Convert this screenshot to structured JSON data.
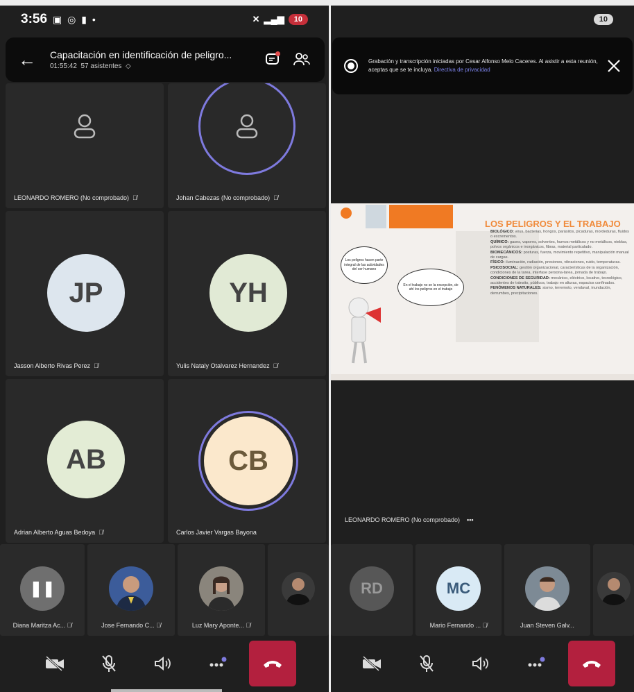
{
  "left": {
    "status": {
      "time": "3:56",
      "battery": "10"
    },
    "header": {
      "title": "Capacitación en identificación de peligro...",
      "duration": "01:55:42",
      "attendees": "57 asistentes"
    },
    "tiles": [
      {
        "name": "LEONARDO ROMERO (No comprobado)"
      },
      {
        "name": "Johan Cabezas (No comprobado)"
      },
      {
        "name": "Jasson Alberto Rivas Perez",
        "initials": "JP",
        "color": "#dde6ee"
      },
      {
        "name": "Yulis Nataly Otalvarez Hernandez",
        "initials": "YH",
        "color": "#e1ead5"
      },
      {
        "name": "Adrian Alberto Aguas Bedoya",
        "initials": "AB",
        "color": "#e3ecd5"
      },
      {
        "name": "Carlos Javier Vargas Bayona",
        "initials": "CB",
        "color": "#fbe8cc"
      }
    ],
    "strip": [
      {
        "name": "Diana Maritza Ac..."
      },
      {
        "name": "Jose Fernando C..."
      },
      {
        "name": "Luz Mary Aponte..."
      },
      {
        "name": ""
      }
    ]
  },
  "right": {
    "status": {
      "battery": "10"
    },
    "banner": {
      "text": "Grabación y transcripción iniciadas por Cesar Alfonso Melo Caceres. Al asistir a esta reunión, aceptas que se te incluya.",
      "link": "Directiva de privacidad"
    },
    "slide": {
      "title": "LOS PELIGROS Y EL TRABAJO",
      "bubble1": "Los peligros hacen parte integral de las actividades del ser humano",
      "bubble2": "En el trabajo no se la excepción, de ahí los peligros en el trabajo",
      "lines": [
        {
          "label": "BIOLÓGICO:",
          "text": "virus, bacterias, hongos, parásitos, picaduras, mordeduras, fluidos o excrementos."
        },
        {
          "label": "QUÍMICO:",
          "text": "gases, vapores, solventes, humos metálicos y no metálicos, nieblas, polvos orgánicos e inorgánicos, fibras, material particulado."
        },
        {
          "label": "BIOMECÁNICOS:",
          "text": "posturas, fuerza, movimiento repetitivo, manipulación manual de cargas."
        },
        {
          "label": "FÍSICO:",
          "text": "iluminación, radiación, presiones, vibraciones, ruido, temperaturas."
        },
        {
          "label": "PSICOSOCIAL:",
          "text": "gestión organizacional, características de la organización, condiciones de la tarea, interfase persona-tarea, jornada de trabajo."
        },
        {
          "label": "CONDICIONES DE SEGURIDAD:",
          "text": "mecánico, eléctrico, locativo, tecnológico, accidentes de tránsito, públicos, trabajo en alturas, espacios confinados."
        },
        {
          "label": "FENÓMENOS NATURALES:",
          "text": "sismo, terremoto, vendaval, inundación, derrumbes, precipitaciones."
        }
      ]
    },
    "presenter": "LEONARDO ROMERO (No comprobado)",
    "strip": [
      {
        "name": "",
        "initials": "RD"
      },
      {
        "name": "Mario Fernando ...",
        "initials": "MC"
      },
      {
        "name": "Juan Steven Galv..."
      },
      {
        "name": ""
      }
    ]
  }
}
